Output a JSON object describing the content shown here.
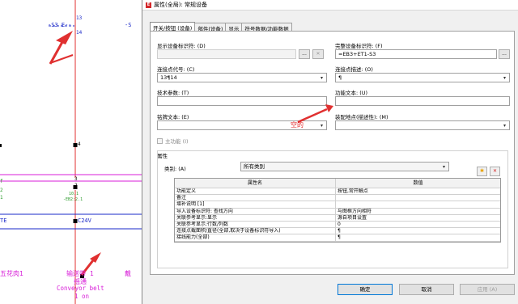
{
  "cad": {
    "device_tag": "-S3 E--",
    "device_tag_right": "-S",
    "pin_top": "13",
    "pin_bottom": "14",
    "node_4": "4",
    "node_3": "3",
    "node_2": "2",
    "node_label_a": "10.1",
    "node_label_b": "-EB2:2.1",
    "left_letter_1": "f",
    "left_letter_2": "2",
    "left_letter_3": "1",
    "bus_left": "TE",
    "bus_right": "C24V",
    "left_cn_text": "五花肉1",
    "right_cn_text": "戴",
    "motor_cn_1": "输送带 1",
    "motor_cn_2": "摇通",
    "motor_en_1": "Conveyor belt",
    "motor_en_2": "1 on",
    "colors": {
      "red_line": "#e03030",
      "magenta": "#d81ed8",
      "blue": "#1a28c8",
      "green": "#2a9a2a"
    }
  },
  "dialog": {
    "title": "属性(全局): 常规设备",
    "tabs": [
      {
        "label": "开关/按钮 (设备)",
        "active": true
      },
      {
        "label": "部件(设备)",
        "active": false
      },
      {
        "label": "显示",
        "active": false
      },
      {
        "label": "符号数据/功能数据",
        "active": false
      }
    ],
    "fields": {
      "display_tag_label": "显示设备标识符: (D)",
      "display_tag_value": "",
      "full_tag_label": "完整设备标识符: (F)",
      "full_tag_value": "=EB3+ET1-S3",
      "conn_code_label": "连接点代号: (C)",
      "conn_code_value": "13¶14",
      "conn_desc_label": "连接点描述: (O)",
      "conn_desc_value": "¶",
      "tech_param_label": "技术参数: (T)",
      "tech_param_value": "",
      "func_text_label": "功能文本: (U)",
      "func_text_value": "",
      "sign_text_label": "铭牌文本: (E)",
      "sign_text_value": "",
      "mount_label": "装配地点(描述性): (M)",
      "mount_value": "",
      "main_func_label": "主功能 (I)",
      "ellipsis": "...",
      "clear": "✕"
    },
    "properties": {
      "group_label": "属性",
      "category_label": "类别: (A)",
      "category_value": "所有类别",
      "col_name": "属性名",
      "col_value": "数值",
      "rows": [
        {
          "name": "功能定义",
          "value": "按钮,常开触点"
        },
        {
          "name": "备注",
          "value": ""
        },
        {
          "name": "增补说明 [1]",
          "value": ""
        },
        {
          "name": "导入设备标识符: 查找方向",
          "value": "与图框方向相符"
        },
        {
          "name": "关联参考显示:显示",
          "value": "源自项目设置"
        },
        {
          "name": "关联参考显示:行数/列数",
          "value": "0"
        },
        {
          "name": "连接点截面积/直径(全部,取决于设备标识符导入)",
          "value": "¶"
        },
        {
          "name": "接线能力(全部)",
          "value": "¶"
        }
      ]
    },
    "buttons": {
      "ok": "确定",
      "cancel": "取消",
      "apply": "应用 (A)"
    },
    "annotation": "空的"
  }
}
